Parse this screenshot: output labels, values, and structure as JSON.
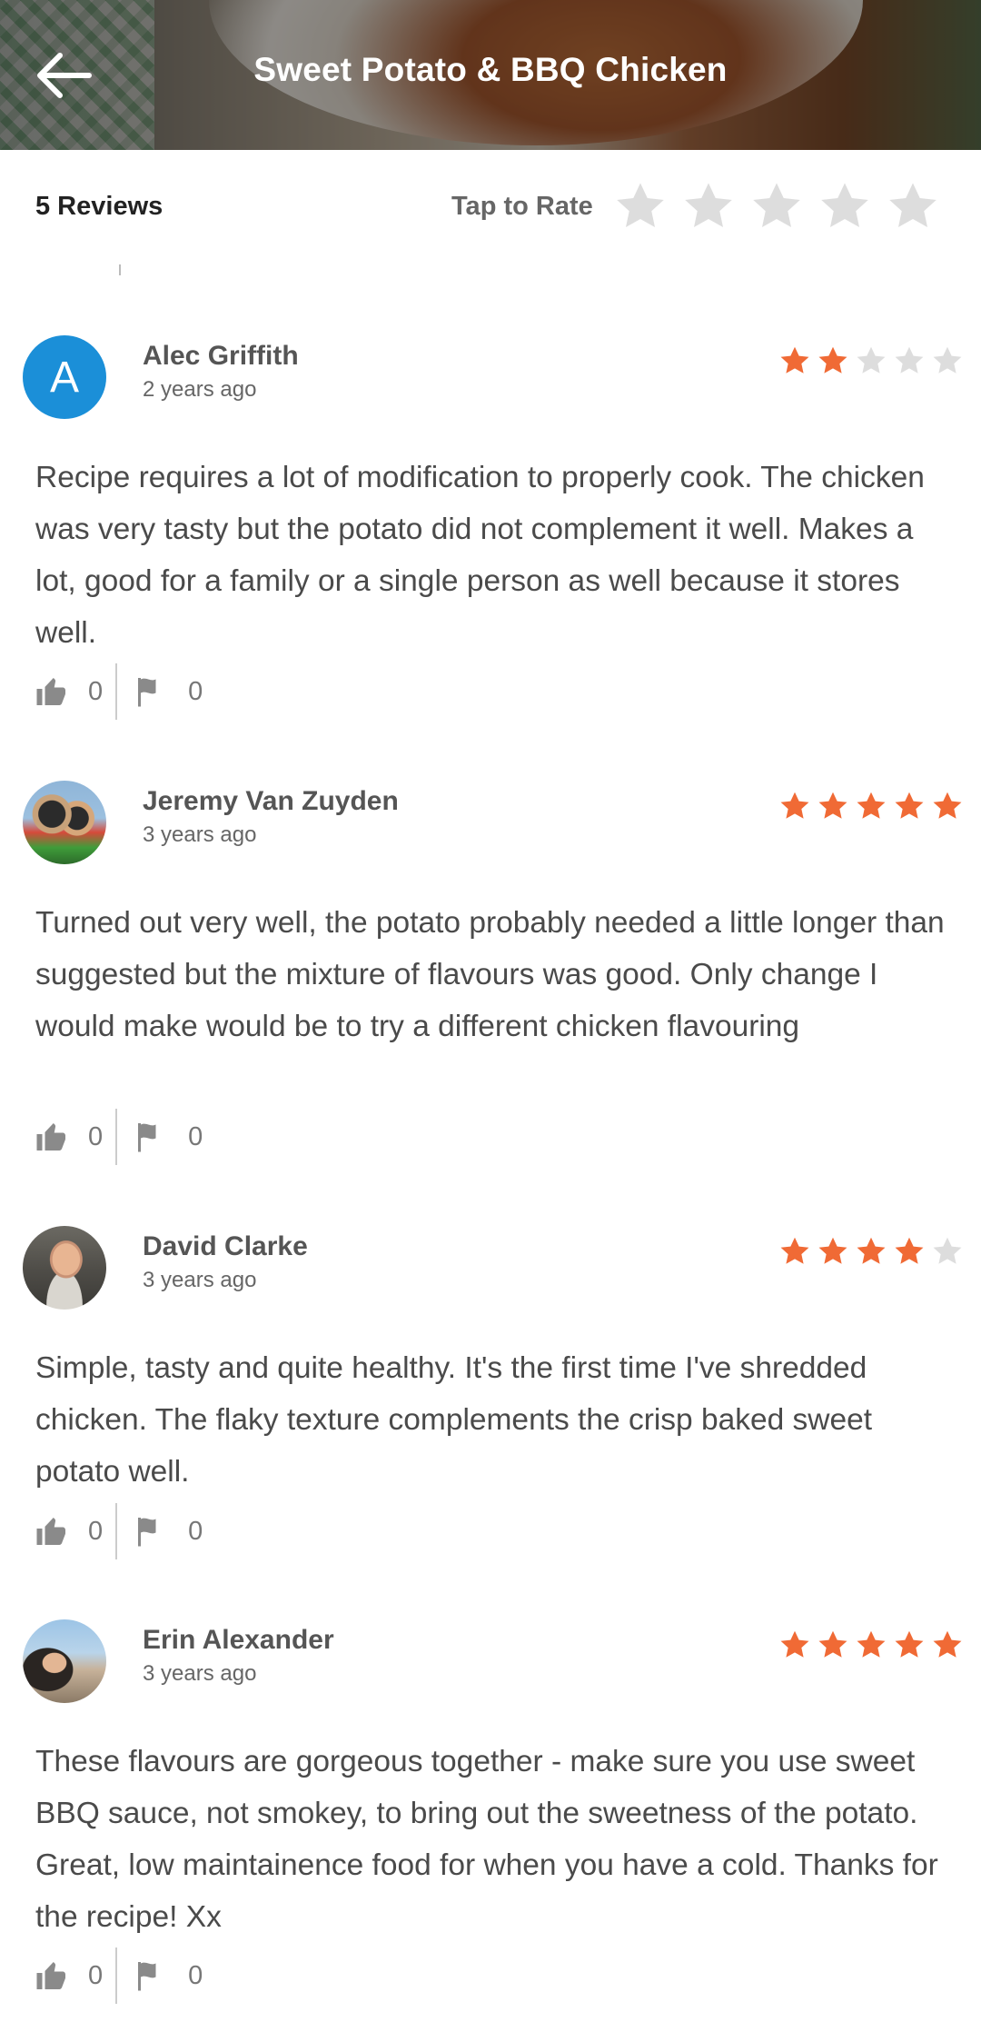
{
  "header": {
    "title": "Sweet Potato & BBQ Chicken"
  },
  "rating_bar": {
    "review_count": "5 Reviews",
    "tap_label": "Tap to Rate"
  },
  "colors": {
    "accent": "#f06a35",
    "star_empty": "#dddddd",
    "avatar_blue": "#1b8fd8"
  },
  "reviews": [
    {
      "name": "Alec Griffith",
      "time": "2 years ago",
      "rating": 2,
      "avatar_letter": "A",
      "text": "Recipe requires a lot of modification to properly cook. The chicken was very tasty but the potato did not complement it well. Makes a lot, good for a family or a single person as well because it stores well.",
      "likes": "0",
      "flags": "0"
    },
    {
      "name": "Jeremy Van Zuyden",
      "time": "3 years ago",
      "rating": 5,
      "text": "Turned out very well, the potato probably needed a little longer than suggested but the mixture of flavours was good. Only change I would make would be to try a different chicken flavouring",
      "likes": "0",
      "flags": "0"
    },
    {
      "name": "David Clarke",
      "time": "3 years ago",
      "rating": 4,
      "text": "Simple, tasty and quite healthy. It's the first time I've shredded chicken. The flaky texture complements the crisp baked sweet potato well.",
      "likes": "0",
      "flags": "0"
    },
    {
      "name": "Erin Alexander",
      "time": "3 years ago",
      "rating": 5,
      "text": "These flavours are gorgeous together - make sure you use sweet BBQ sauce, not smokey, to bring out the sweetness of the potato. Great, low maintainence food for when you have a cold. Thanks for the recipe! Xx",
      "likes": "0",
      "flags": "0"
    }
  ]
}
